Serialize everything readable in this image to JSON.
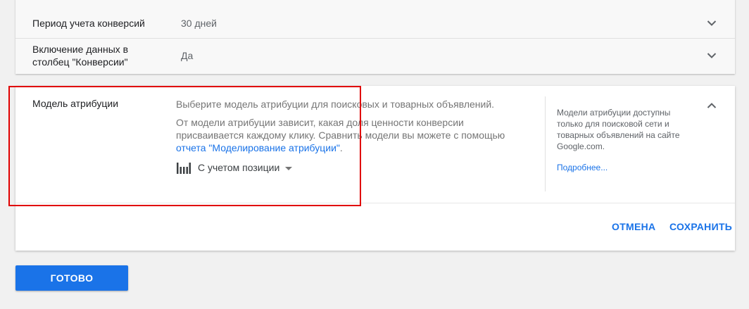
{
  "settings": {
    "rows": [
      {
        "label": "Период учета конверсий",
        "value": "30 дней",
        "icon": "chevron-down-icon"
      },
      {
        "label": "Включение данных в столбец \"Конверсии\"",
        "value": "Да",
        "icon": "chevron-down-icon"
      }
    ]
  },
  "attribution": {
    "label": "Модель атрибуции",
    "description_1": "Выберите модель атрибуции для поисковых и товарных объявлений.",
    "description_2_before": "От модели атрибуции зависит, какая доля ценности конверсии присваивается каждому клику. Сравнить модели вы можете с помощью ",
    "description_2_link": "отчета \"Моделирование атрибуции\"",
    "description_2_after": ".",
    "selected_model": "С учетом позиции",
    "model_icon": "position-based-bars-icon",
    "side_note": "Модели атрибуции доступны только для поисковой сети и товарных объявлений на сайте Google.com.",
    "side_link": "Подробнее...",
    "collapse_icon": "chevron-up-icon",
    "cancel_label": "ОТМЕНА",
    "save_label": "СОХРАНИТЬ"
  },
  "footer": {
    "done_label": "ГОТОВО"
  },
  "colors": {
    "accent": "#1a73e8",
    "highlight": "#e00000",
    "background": "#f1f1f1"
  }
}
